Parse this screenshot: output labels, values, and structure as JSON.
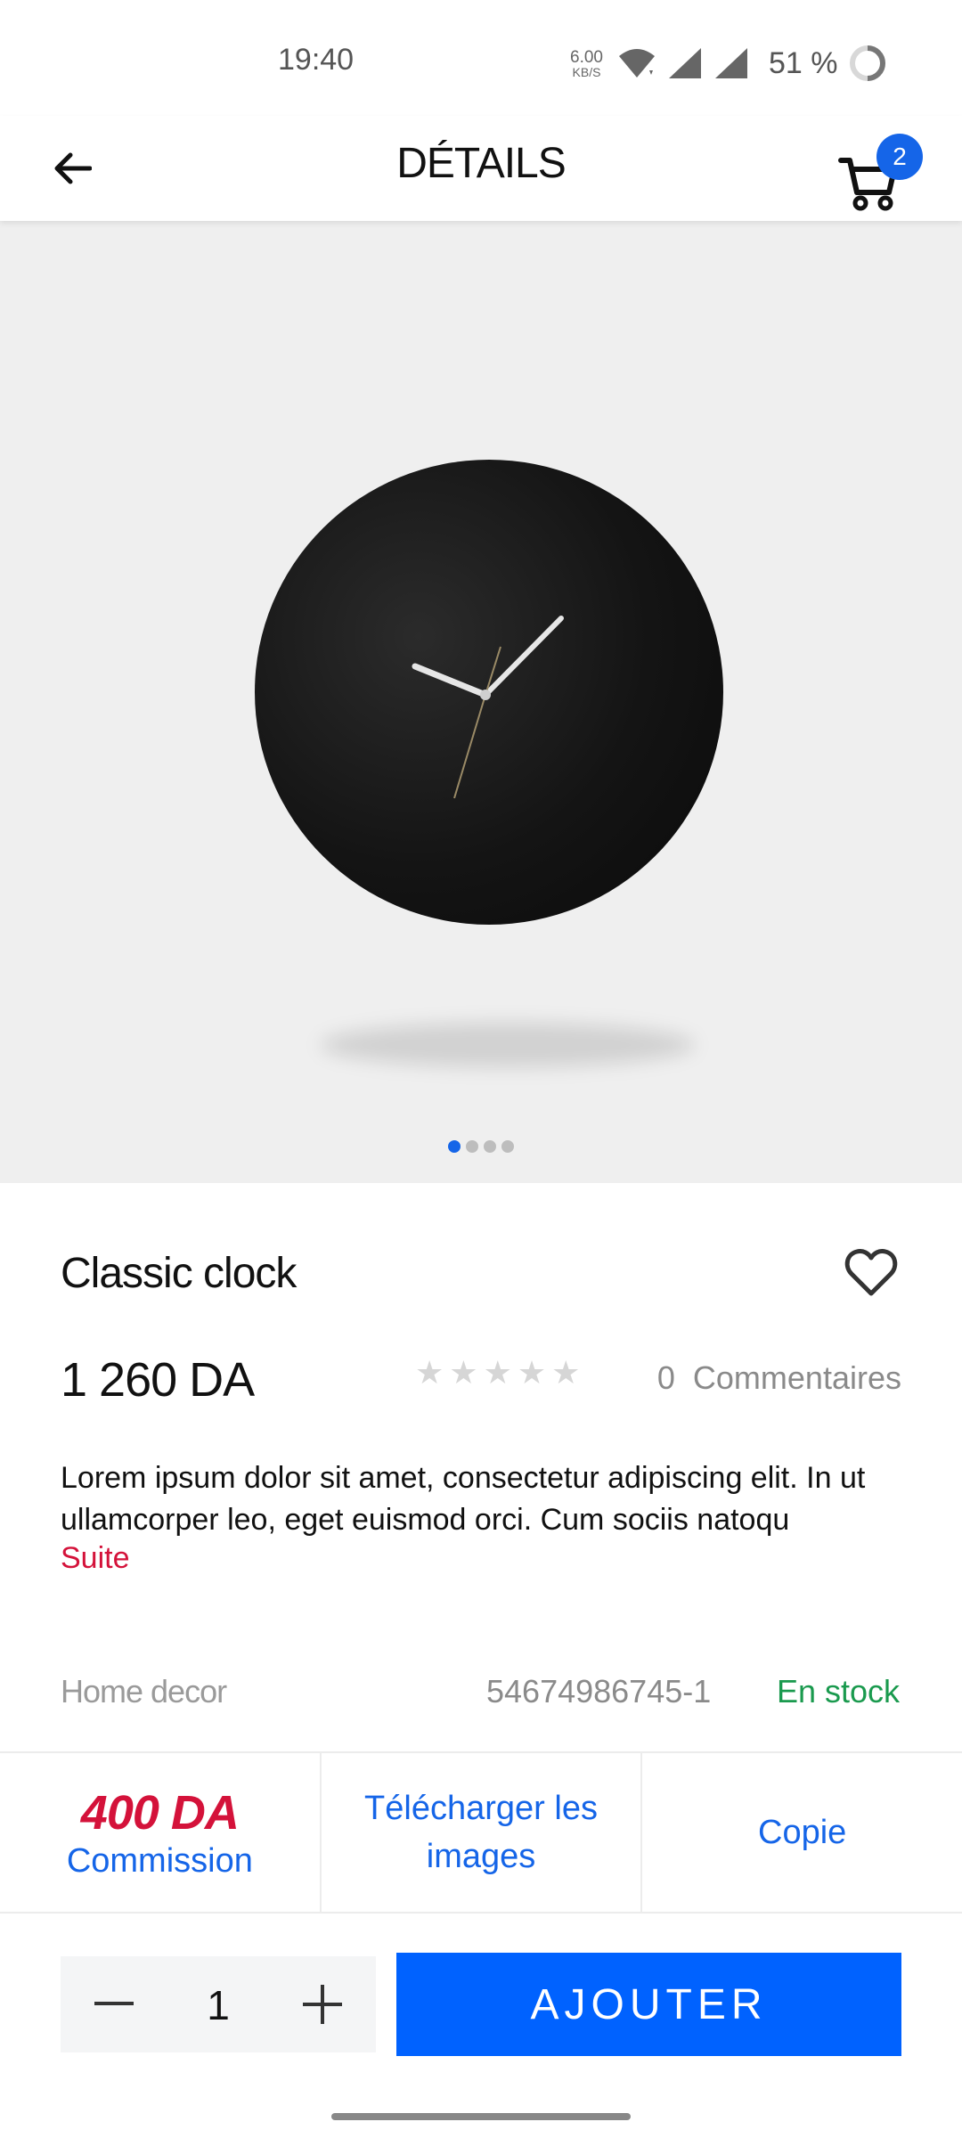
{
  "status_bar": {
    "time": "19:40",
    "net_speed_value": "6.00",
    "net_speed_unit": "KB/S",
    "battery_percent": "51 %"
  },
  "header": {
    "title": "DÉTAILS",
    "cart_count": "2"
  },
  "gallery": {
    "image_subject": "black wall clock",
    "image_count": 4,
    "active_index": 0
  },
  "product": {
    "name": "Classic clock",
    "price": "1 260 DA",
    "rating": 0,
    "rating_max": 5,
    "comments": "0  Commentaires",
    "description": "Lorem ipsum dolor sit amet, consectetur adipiscing elit. In ut ullamcorper leo, eget euismod orci. Cum sociis natoqu",
    "more_label": "Suite",
    "category": "Home decor",
    "sku": "54674986745-1",
    "stock_status": "En stock"
  },
  "actions": {
    "commission_amount": "400 DA",
    "commission_label": "Commission",
    "download_label": "Télécharger les images",
    "copy_label": "Copie"
  },
  "cart_controls": {
    "quantity": "1",
    "add_label": "AJOUTER"
  },
  "colors": {
    "accent_blue": "#0062ff",
    "brand_red": "#d4123a",
    "stock_green": "#1a9a4e"
  },
  "icons": {
    "back": "arrow-left-icon",
    "cart": "shopping-cart-icon",
    "favorite": "heart-outline-icon",
    "minus": "minus-icon",
    "plus": "plus-icon"
  }
}
